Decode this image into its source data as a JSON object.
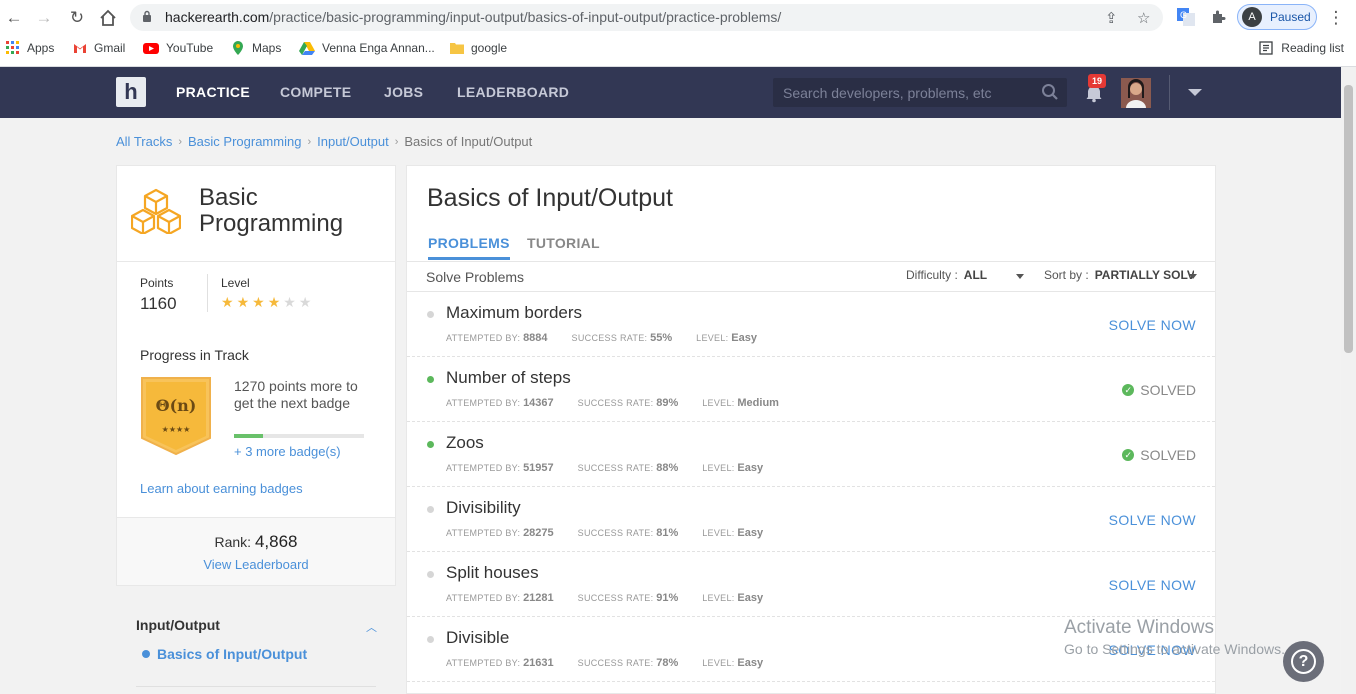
{
  "browser": {
    "url_host": "hackerearth.com",
    "url_path": "/practice/basic-programming/input-output/basics-of-input-output/practice-problems/",
    "profile_initial": "A",
    "profile_status": "Paused",
    "bookmarks": [
      "Apps",
      "Gmail",
      "YouTube",
      "Maps",
      "Venna Enga Annan...",
      "google"
    ],
    "reading_list": "Reading list"
  },
  "nav": {
    "logo": "h",
    "links": [
      "PRACTICE",
      "COMPETE",
      "JOBS",
      "LEADERBOARD"
    ],
    "search_placeholder": "Search developers, problems, etc",
    "notification_count": "19"
  },
  "breadcrumb": {
    "items": [
      "All Tracks",
      "Basic Programming",
      "Input/Output"
    ],
    "current": "Basics of Input/Output"
  },
  "track": {
    "title": "Basic Programming",
    "points_label": "Points",
    "points_value": "1160",
    "level_label": "Level",
    "level_stars": 4,
    "level_max": 6,
    "progress_label": "Progress in Track",
    "badge_symbol": "Θ(n)",
    "badge_stars": "★★★★",
    "badge_text": "1270 points more to get the next badge",
    "badge_progress": 0.22,
    "more_badges": "+ 3 more badge(s)",
    "learn_link": "Learn about earning badges",
    "rank_label": "Rank:",
    "rank_value": "4,868",
    "leaderboard_link": "View Leaderboard"
  },
  "sidenav": {
    "section": "Input/Output",
    "item": "Basics of Input/Output"
  },
  "main": {
    "title": "Basics of Input/Output",
    "tabs": [
      "PROBLEMS",
      "TUTORIAL"
    ],
    "solve_label": "Solve Problems",
    "difficulty_label": "Difficulty :",
    "difficulty_value": "ALL",
    "sort_label": "Sort by :",
    "sort_value": "PARTIALLY SOLVED",
    "meta_labels": {
      "attempted": "ATTEMPTED BY:",
      "success": "SUCCESS RATE:",
      "level": "LEVEL:"
    },
    "problems": [
      {
        "name": "Maximum borders",
        "attempted": "8884",
        "success": "55%",
        "level": "Easy",
        "status": "SOLVE NOW",
        "solved": false
      },
      {
        "name": "Number of steps",
        "attempted": "14367",
        "success": "89%",
        "level": "Medium",
        "status": "SOLVED",
        "solved": true
      },
      {
        "name": "Zoos",
        "attempted": "51957",
        "success": "88%",
        "level": "Easy",
        "status": "SOLVED",
        "solved": true
      },
      {
        "name": "Divisibility",
        "attempted": "28275",
        "success": "81%",
        "level": "Easy",
        "status": "SOLVE NOW",
        "solved": false
      },
      {
        "name": "Split houses",
        "attempted": "21281",
        "success": "91%",
        "level": "Easy",
        "status": "SOLVE NOW",
        "solved": false
      },
      {
        "name": "Divisible",
        "attempted": "21631",
        "success": "78%",
        "level": "Easy",
        "status": "SOLVE NOW",
        "solved": false
      }
    ]
  },
  "watermark": {
    "line1": "Activate Windows",
    "line2": "Go to Settings to activate Windows."
  },
  "colors": {
    "nav_bg": "#323754",
    "accent": "#4a90d9",
    "solved_green": "#5cb85c",
    "star": "#f6b93b"
  }
}
